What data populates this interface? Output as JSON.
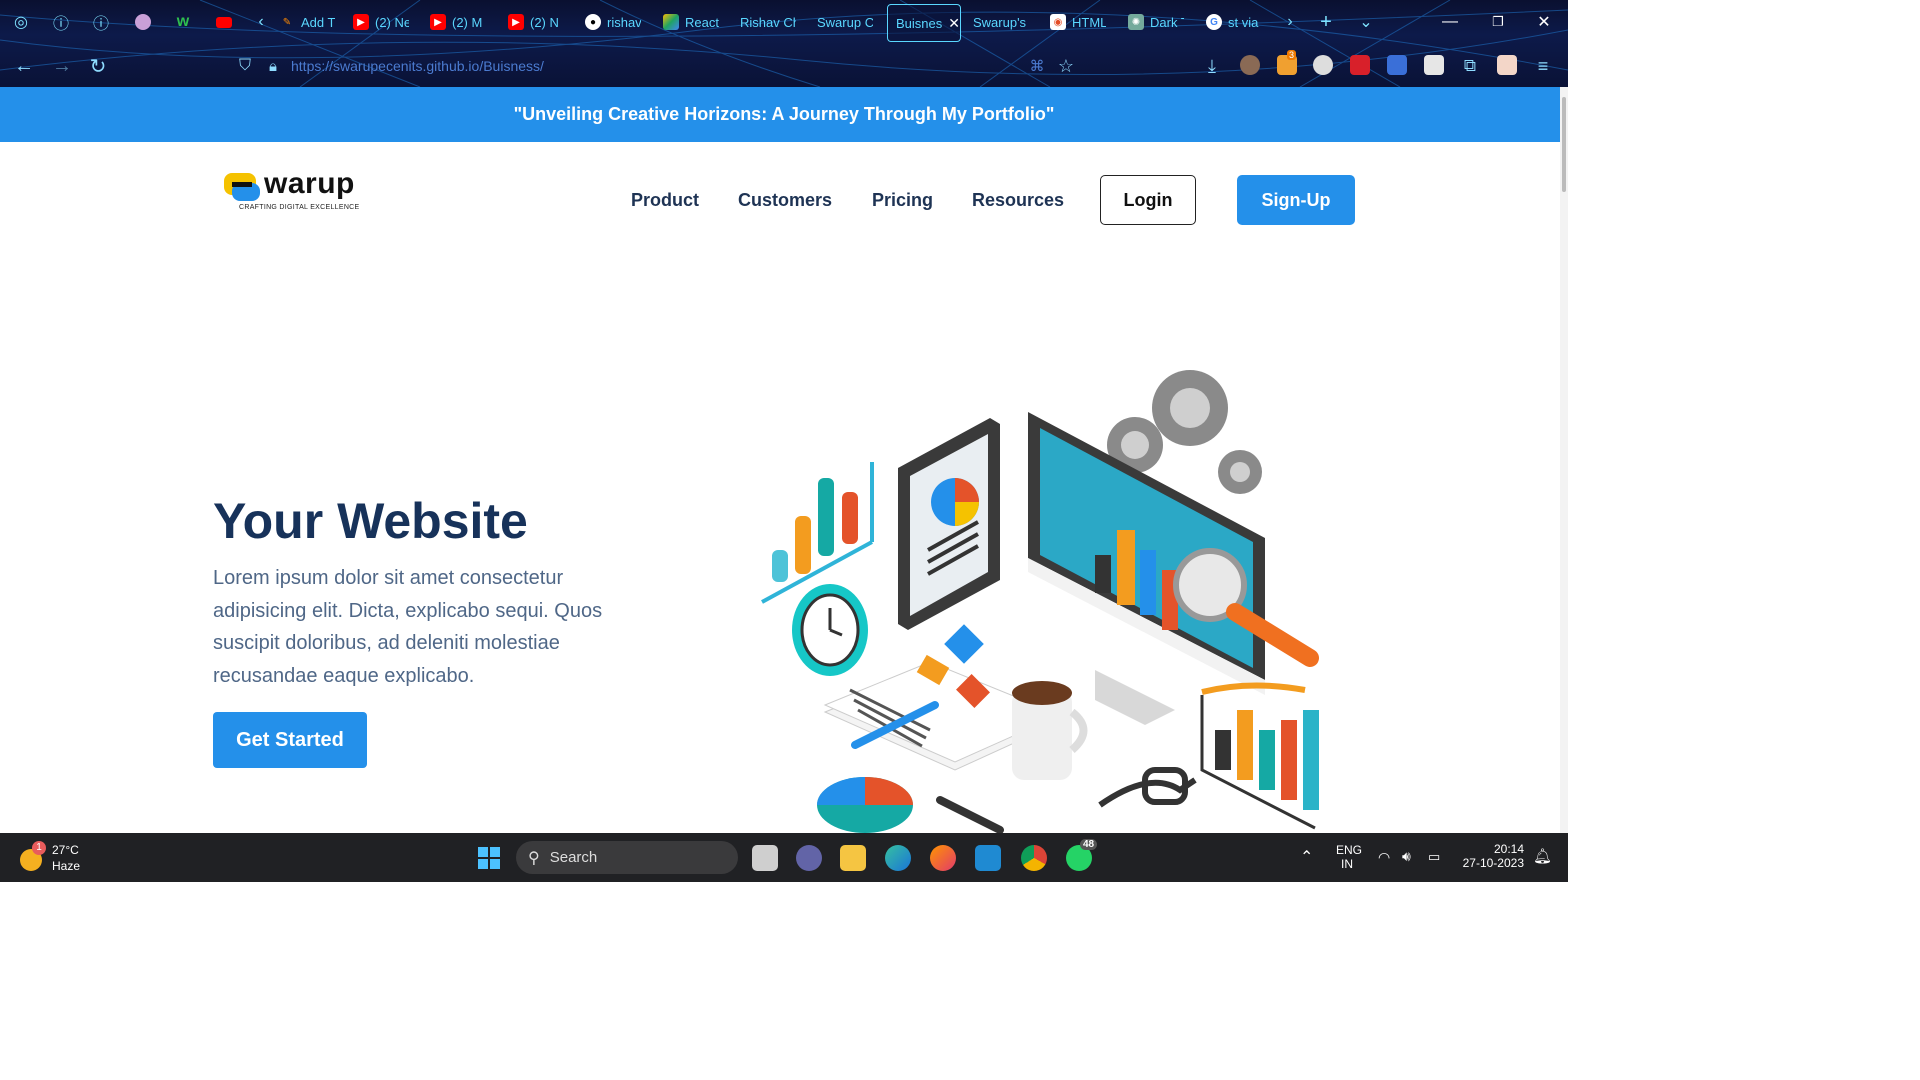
{
  "browser": {
    "tabs": [
      {
        "label": "Add T",
        "icon": "feather-icon",
        "color": "#ff8a00"
      },
      {
        "label": "(2) Ne",
        "icon": "youtube-icon",
        "color": "#ff0000"
      },
      {
        "label": "(2) M",
        "icon": "youtube-icon",
        "color": "#ff0000"
      },
      {
        "label": "(2) N",
        "icon": "youtube-icon",
        "color": "#ff0000"
      },
      {
        "label": "rishav",
        "icon": "github-icon",
        "color": "#ffffff"
      },
      {
        "label": "React",
        "icon": "drive-icon",
        "color": "#1fa463"
      },
      {
        "label": "Rishav Ch",
        "icon": "",
        "color": ""
      },
      {
        "label": "Swarup C",
        "icon": "",
        "color": ""
      },
      {
        "label": "Buisnes",
        "icon": "",
        "color": "",
        "active": true
      },
      {
        "label": "Swarup's P",
        "icon": "",
        "color": ""
      },
      {
        "label": "HTML",
        "icon": "html-icon",
        "color": "#e44d26"
      },
      {
        "label": "Dark T",
        "icon": "openai-icon",
        "color": "#74aa9c"
      },
      {
        "label": "st via",
        "icon": "google-icon",
        "color": "#4285f4"
      }
    ],
    "url": "https://swarupecenits.github.io/Buisness/",
    "extension_badge": "3"
  },
  "site": {
    "banner": "\"Unveiling Creative Horizons: A Journey Through My Portfolio\"",
    "logo_word": "warup",
    "logo_tagline": "CRAFTING DIGITAL EXCELLENCE",
    "nav": [
      "Product",
      "Customers",
      "Pricing",
      "Resources"
    ],
    "login": "Login",
    "signup": "Sign-Up",
    "hero_title": "Your Website",
    "hero_text": "Lorem ipsum dolor sit amet consectetur adipisicing elit. Dicta, explicabo sequi. Quos suscipit doloribus, ad deleniti molestiae recusandae eaque explicabo.",
    "cta": "Get Started",
    "accent": "#2490ea",
    "heading_color": "#17325a"
  },
  "taskbar": {
    "weather_temp": "27°C",
    "weather_desc": "Haze",
    "weather_badge": "1",
    "search": "Search",
    "whatsapp_badge": "48",
    "lang": "ENG",
    "region": "IN",
    "time": "20:14",
    "date": "27-10-2023"
  }
}
